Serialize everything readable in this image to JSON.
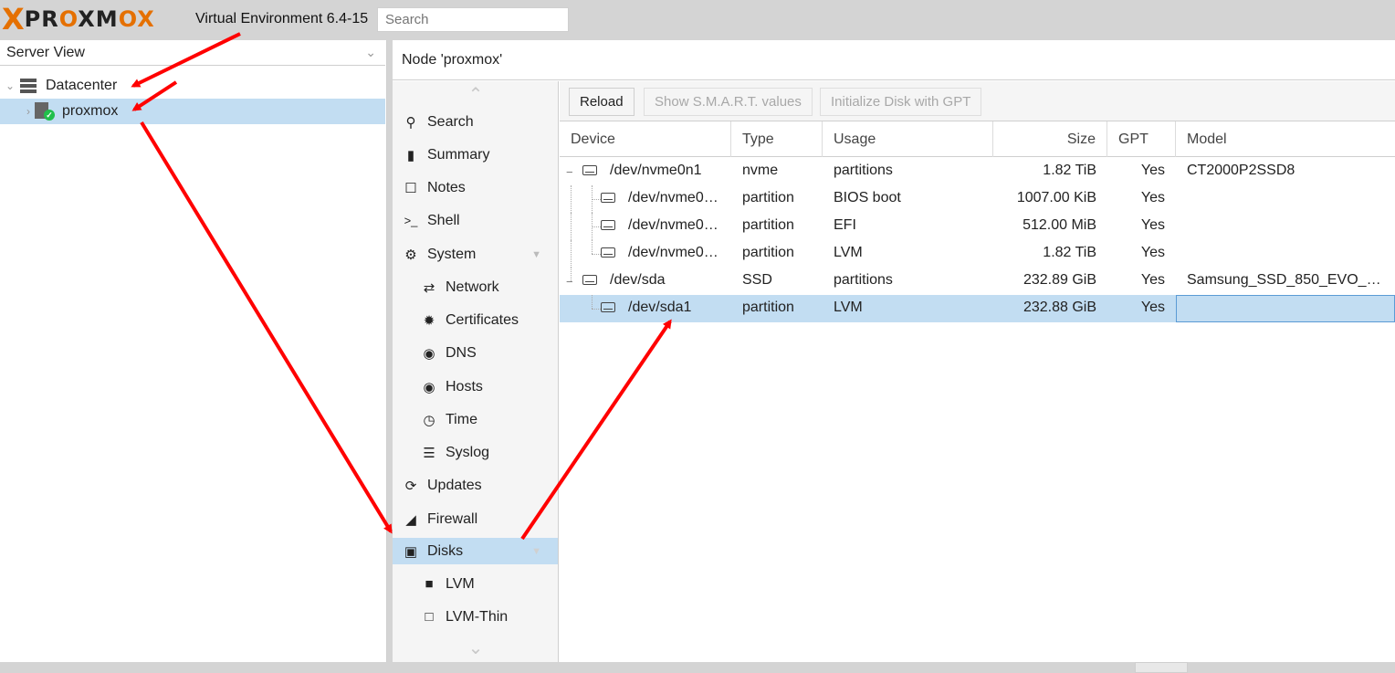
{
  "header": {
    "logo_text_1": "PR",
    "logo_text_2": "O",
    "logo_text_3": "XM",
    "logo_text_4": "O",
    "logo_x": "X",
    "logo_end": "X",
    "version": "Virtual Environment 6.4-15",
    "search_placeholder": "Search"
  },
  "left_panel": {
    "view_select": "Server View",
    "tree": [
      {
        "label": "Datacenter",
        "icon": "datacenter-icon"
      },
      {
        "label": "proxmox",
        "icon": "node-online-icon",
        "selected": true
      }
    ]
  },
  "content": {
    "title": "Node 'proxmox'"
  },
  "nav": {
    "items": [
      {
        "label": "Search",
        "icon": "search-icon"
      },
      {
        "label": "Summary",
        "icon": "book-icon"
      },
      {
        "label": "Notes",
        "icon": "note-icon"
      },
      {
        "label": "Shell",
        "icon": "terminal-icon"
      },
      {
        "label": "System",
        "icon": "gears-icon"
      },
      {
        "label": "Network",
        "icon": "exchange-icon"
      },
      {
        "label": "Certificates",
        "icon": "certificate-icon"
      },
      {
        "label": "DNS",
        "icon": "globe-icon"
      },
      {
        "label": "Hosts",
        "icon": "globe-icon"
      },
      {
        "label": "Time",
        "icon": "clock-icon"
      },
      {
        "label": "Syslog",
        "icon": "list-icon"
      },
      {
        "label": "Updates",
        "icon": "refresh-icon"
      },
      {
        "label": "Firewall",
        "icon": "shield-icon"
      },
      {
        "label": "Disks",
        "icon": "hdd-icon",
        "selected": true
      },
      {
        "label": "LVM",
        "icon": "square-icon"
      },
      {
        "label": "LVM-Thin",
        "icon": "square-outline-icon"
      }
    ]
  },
  "toolbar": {
    "reload": "Reload",
    "smart": "Show S.M.A.R.T. values",
    "init_gpt": "Initialize Disk with GPT"
  },
  "grid": {
    "columns": [
      "Device",
      "Type",
      "Usage",
      "Size",
      "GPT",
      "Model"
    ],
    "rows": [
      {
        "device": "/dev/nvme0n1",
        "type": "nvme",
        "usage": "partitions",
        "size": "1.82 TiB",
        "gpt": "Yes",
        "model": "CT2000P2SSD8"
      },
      {
        "device": "/dev/nvme0n…",
        "type": "partition",
        "usage": "BIOS boot",
        "size": "1007.00 KiB",
        "gpt": "Yes",
        "model": ""
      },
      {
        "device": "/dev/nvme0n…",
        "type": "partition",
        "usage": "EFI",
        "size": "512.00 MiB",
        "gpt": "Yes",
        "model": ""
      },
      {
        "device": "/dev/nvme0n…",
        "type": "partition",
        "usage": "LVM",
        "size": "1.82 TiB",
        "gpt": "Yes",
        "model": ""
      },
      {
        "device": "/dev/sda",
        "type": "SSD",
        "usage": "partitions",
        "size": "232.89 GiB",
        "gpt": "Yes",
        "model": "Samsung_SSD_850_EVO_2…"
      },
      {
        "device": "/dev/sda1",
        "type": "partition",
        "usage": "LVM",
        "size": "232.88 GiB",
        "gpt": "Yes",
        "model": "",
        "selected": true
      }
    ]
  },
  "colors": {
    "brand_orange": "#e57000",
    "selection": "#c2ddf2",
    "annotation_arrow": "#ff0000"
  }
}
